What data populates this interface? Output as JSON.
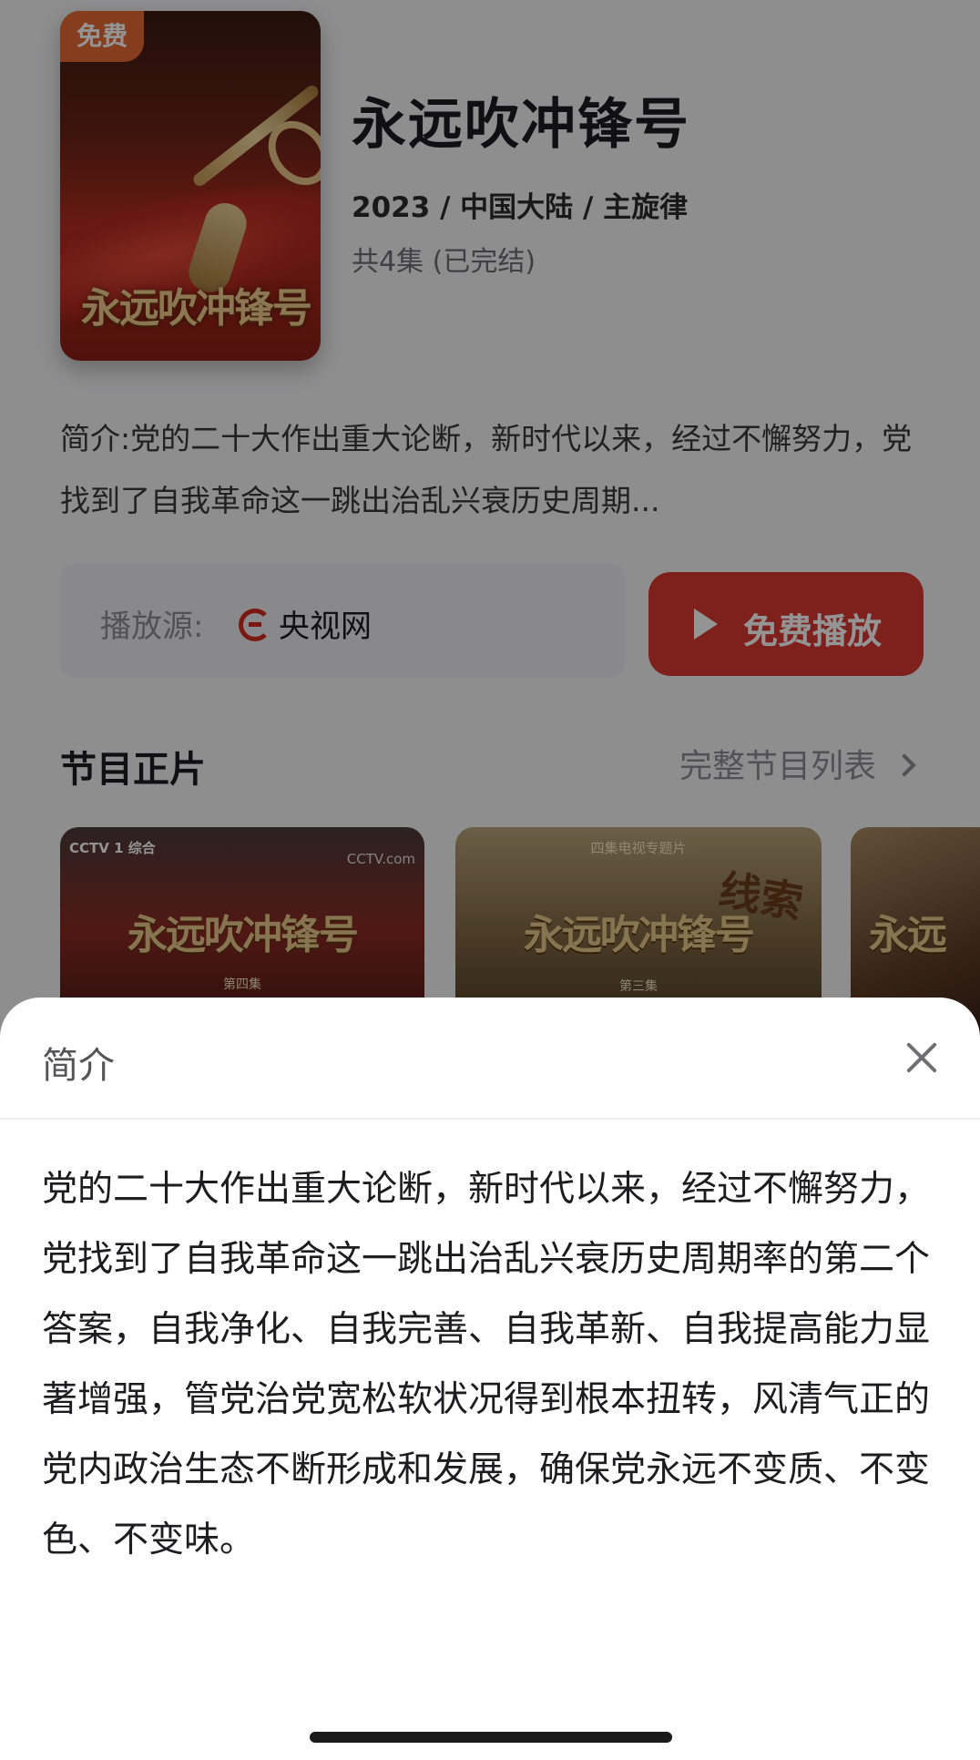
{
  "show": {
    "badge": "免费",
    "poster_title": "永远吹冲锋号",
    "title": "永远吹冲锋号",
    "meta": "2023 / 中国大陆 / 主旋律",
    "episodes": "共4集 (已完结)",
    "intro": "简介:党的二十大作出重大论断，新时代以来，经过不懈努力，党找到了自我革命这一跳出治乱兴衰历史周期..."
  },
  "source": {
    "label": "播放源:",
    "name": "央视网",
    "icon": "cctv-logo-icon"
  },
  "play_button": {
    "label": "免费播放",
    "icon": "play-icon",
    "color": "#d93a32"
  },
  "episodes_section": {
    "title": "节目正片",
    "full_list": "完整节目列表",
    "thumbnails": [
      {
        "title": "永远吹冲锋号",
        "caption": "第四集",
        "channel": "CCTV 1 综合",
        "corner": "CCTV.com"
      },
      {
        "title": "永远吹冲锋号",
        "top_caption": "四集电视专题片",
        "side": "线索",
        "caption": "第三集"
      },
      {
        "title": "永远"
      }
    ]
  },
  "sheet": {
    "title": "简介",
    "close_icon": "close-icon",
    "body": "党的二十大作出重大论断，新时代以来，经过不懈努力，党找到了自我革命这一跳出治乱兴衰历史周期率的第二个答案，自我净化、自我完善、自我革新、自我提高能力显著增强，管党治党宽松软状况得到根本扭转，风清气正的党内政治生态不断形成和发展，确保党永远不变质、不变色、不变味。"
  },
  "colors": {
    "accent_red": "#d93a32",
    "badge_orange": "#e56a33",
    "overlay": "rgba(0,0,0,0.42)"
  }
}
